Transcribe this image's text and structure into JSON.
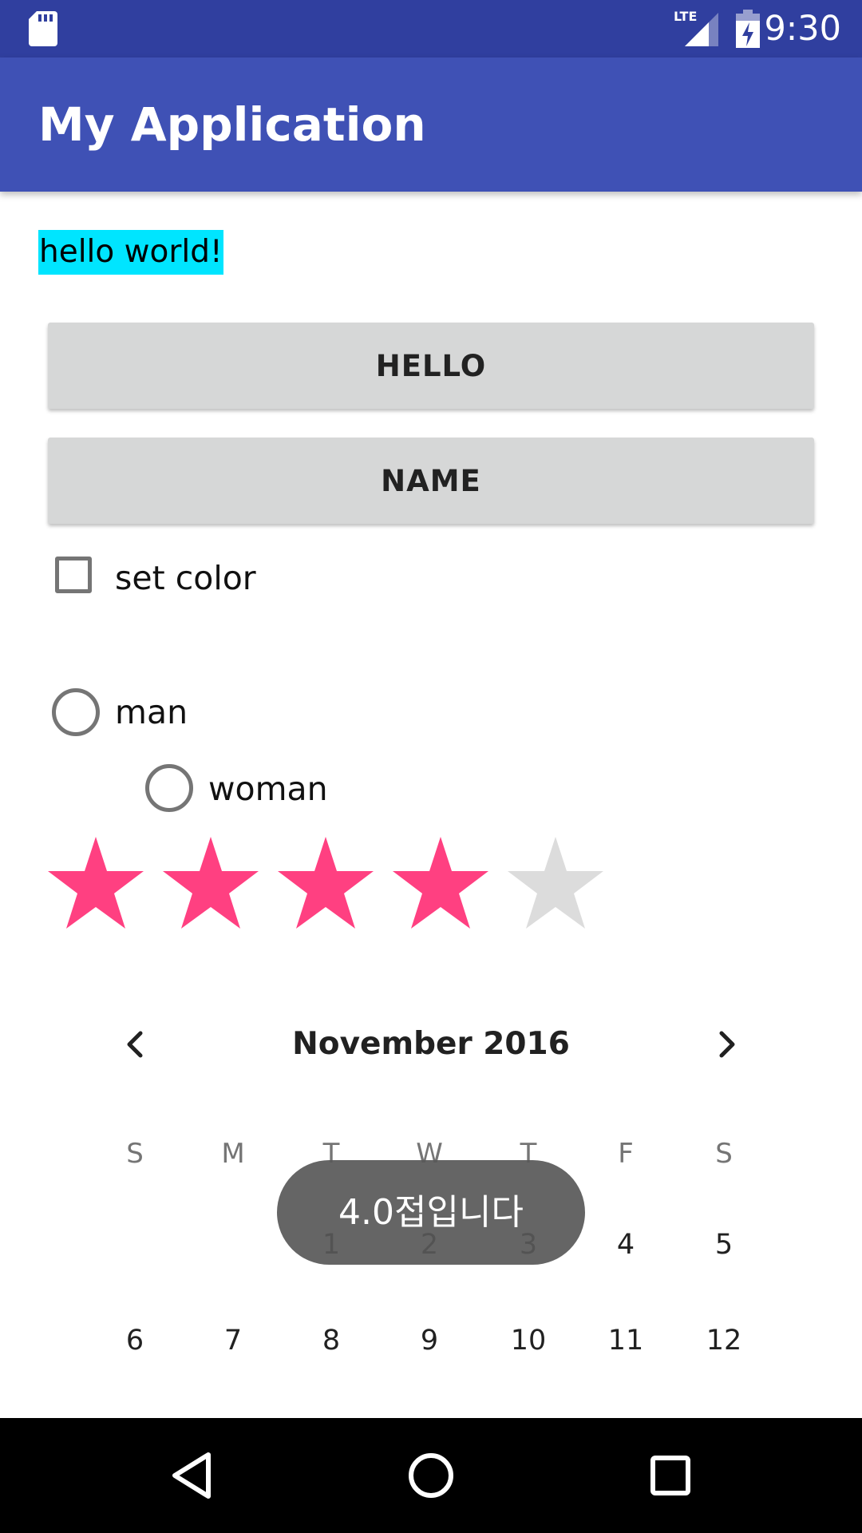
{
  "status_bar": {
    "time": "9:30",
    "network": "LTE",
    "icons": [
      "sd-card-icon",
      "signal-icon",
      "battery-charging-icon"
    ],
    "background": "#303f9f"
  },
  "app_bar": {
    "title": "My Application",
    "background": "#3f51b5"
  },
  "main": {
    "hello_text": "hello world!",
    "hello_text_background": "#00e5ff",
    "buttons": [
      {
        "label": "HELLO"
      },
      {
        "label": "NAME"
      }
    ],
    "checkbox": {
      "label": "set color",
      "checked": false
    },
    "radio_group": [
      {
        "label": "man",
        "checked": false
      },
      {
        "label": "woman",
        "checked": false
      }
    ],
    "rating": {
      "value": 4,
      "max": 5,
      "filled_color": "#ff4081",
      "empty_color": "#dcdcdc"
    }
  },
  "calendar": {
    "month_title": "November 2016",
    "weekdays": [
      "S",
      "M",
      "T",
      "W",
      "T",
      "F",
      "S"
    ],
    "week_rows": [
      [
        "",
        "",
        "1",
        "2",
        "3",
        "4",
        "5"
      ],
      [
        "6",
        "7",
        "8",
        "9",
        "10",
        "11",
        "12"
      ]
    ]
  },
  "toast": {
    "text": "4.0접입니다"
  },
  "nav_bar": {
    "icons": [
      "back-icon",
      "home-icon",
      "recents-icon"
    ]
  }
}
